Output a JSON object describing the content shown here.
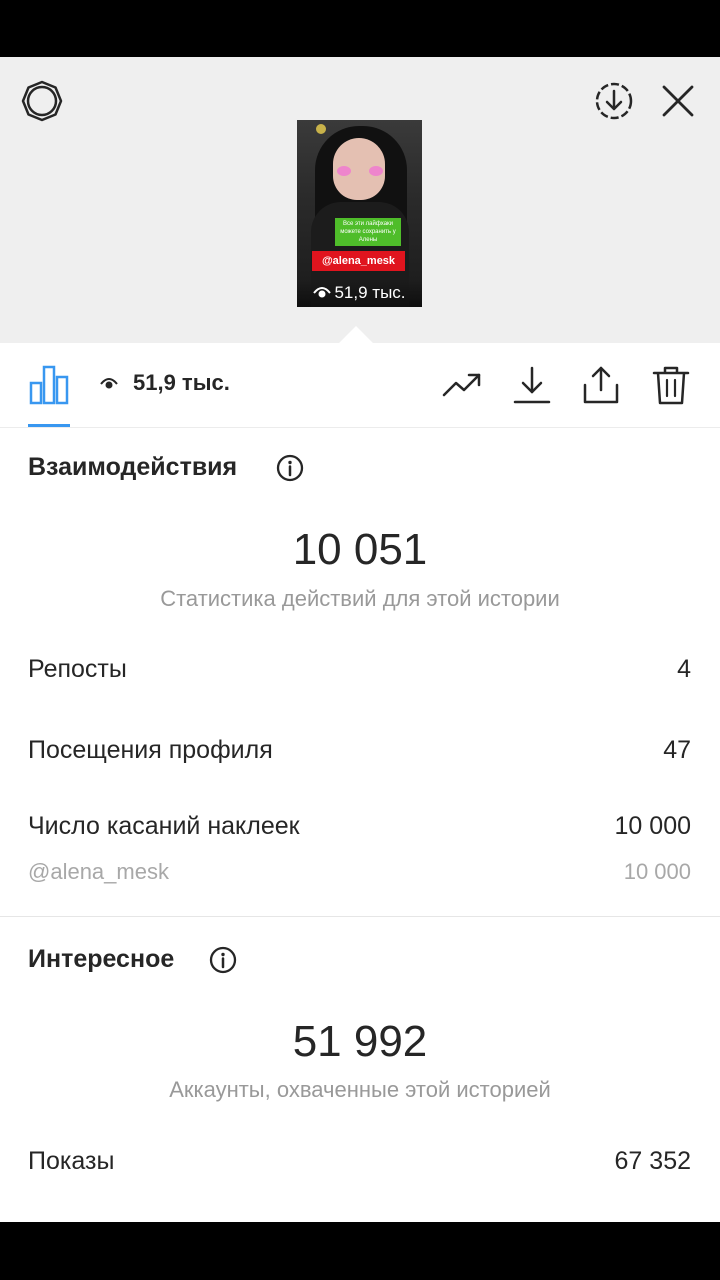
{
  "story_preview": {
    "sticker_text": "Все эти лайфхаки можете сохранить у Алены",
    "mention": "@alena_mesk",
    "views": "51,9 тыс."
  },
  "toolbar": {
    "views": "51,9 тыс."
  },
  "interactions": {
    "title": "Взаимодействия",
    "total": "10 051",
    "subtitle": "Статистика действий для этой истории",
    "rows": [
      {
        "label": "Репосты",
        "value": "4"
      },
      {
        "label": "Посещения профиля",
        "value": "47"
      },
      {
        "label": "Число касаний наклеек",
        "value": "10 000"
      }
    ],
    "sub_row": {
      "label": "@alena_mesk",
      "value": "10 000"
    }
  },
  "discovery": {
    "title": "Интересное",
    "total": "51 992",
    "subtitle": "Аккаунты, охваченные этой историей",
    "rows": [
      {
        "label": "Показы",
        "value": "67 352"
      }
    ]
  },
  "colors": {
    "accent": "#3897f0",
    "text": "#262626",
    "muted": "#999999",
    "sticker_red": "#e0141e",
    "sticker_green": "#4fbd2a"
  }
}
